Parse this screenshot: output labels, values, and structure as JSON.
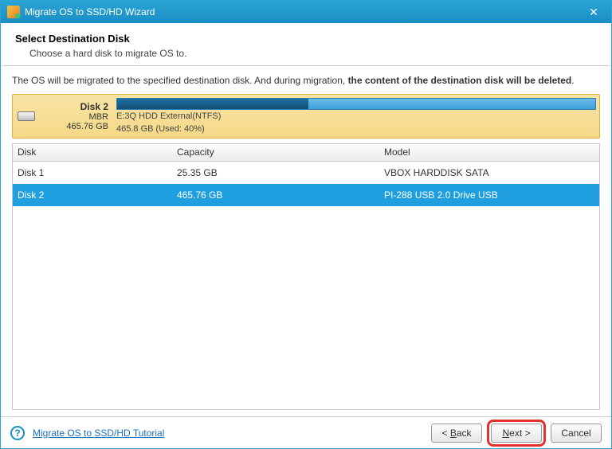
{
  "titlebar": {
    "title": "Migrate OS to SSD/HD Wizard"
  },
  "header": {
    "heading": "Select Destination Disk",
    "sub": "Choose a hard disk to migrate OS to."
  },
  "warning": {
    "pre": "The OS will be migrated to the specified destination disk. And during migration, ",
    "bold": "the content of the destination disk will be deleted",
    "suffix": "."
  },
  "diskPanel": {
    "name": "Disk 2",
    "scheme": "MBR",
    "size": "465.76 GB",
    "partLabel": "E:3Q HDD External(NTFS)",
    "usage": "465.8 GB (Used: 40%)",
    "usedPercent": 40
  },
  "table": {
    "columns": {
      "disk": "Disk",
      "capacity": "Capacity",
      "model": "Model"
    },
    "rows": [
      {
        "disk": "Disk 1",
        "capacity": "25.35 GB",
        "model": "VBOX HARDDISK SATA",
        "selected": false
      },
      {
        "disk": "Disk 2",
        "capacity": "465.76 GB",
        "model": "PI-288 USB 2.0 Drive USB",
        "selected": true
      }
    ]
  },
  "footer": {
    "tutorial": "Migrate OS to SSD/HD Tutorial",
    "back": "< Back",
    "next": "Next >",
    "cancel": "Cancel",
    "backU": "B",
    "nextU": "N"
  }
}
